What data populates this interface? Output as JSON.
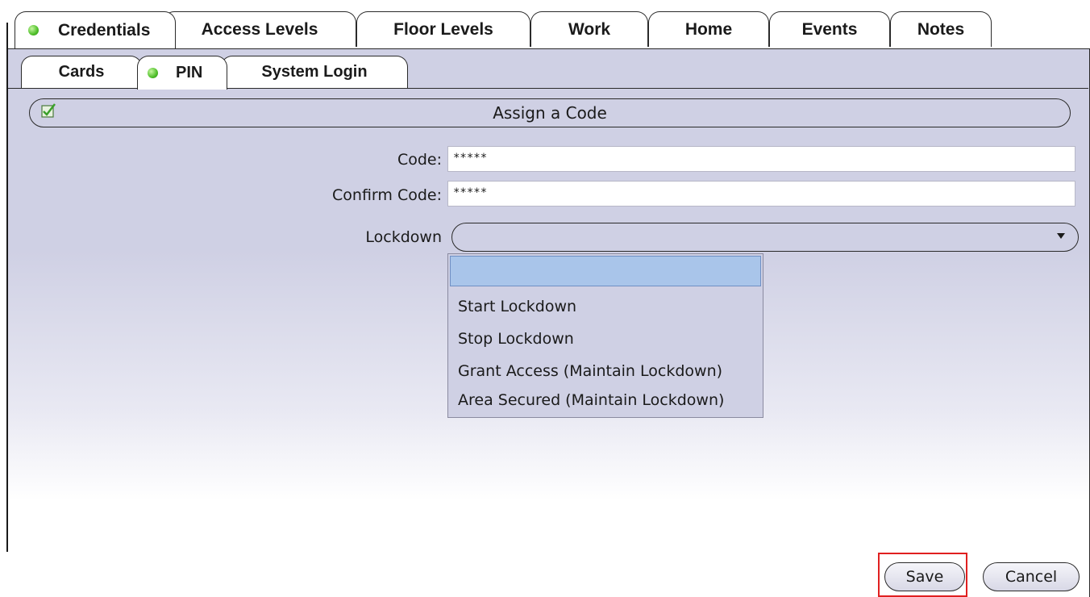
{
  "tabs": [
    {
      "label": "Credentials",
      "active": true,
      "status": "green"
    },
    {
      "label": "Access Levels"
    },
    {
      "label": "Floor Levels"
    },
    {
      "label": "Work"
    },
    {
      "label": "Home"
    },
    {
      "label": "Events"
    },
    {
      "label": "Notes"
    }
  ],
  "subtabs": [
    {
      "label": "Cards"
    },
    {
      "label": "PIN",
      "active": true,
      "status": "green"
    },
    {
      "label": "System Login"
    }
  ],
  "section": {
    "title": "Assign a Code",
    "enabled": true
  },
  "form": {
    "code_label": "Code:",
    "code_value": "*****",
    "confirm_label": "Confirm Code:",
    "confirm_value": "*****",
    "lockdown_label": "Lockdown",
    "lockdown_value": ""
  },
  "lockdown_options": [
    "",
    "Start Lockdown",
    "Stop Lockdown",
    "Grant Access (Maintain Lockdown)",
    "Area Secured (Maintain Lockdown)"
  ],
  "buttons": {
    "save": "Save",
    "cancel": "Cancel"
  },
  "colors": {
    "panel": "#cfd0e4",
    "highlight": "#e02020",
    "selected_option": "#a9c5ea",
    "status_green": "#4fbf2a"
  }
}
